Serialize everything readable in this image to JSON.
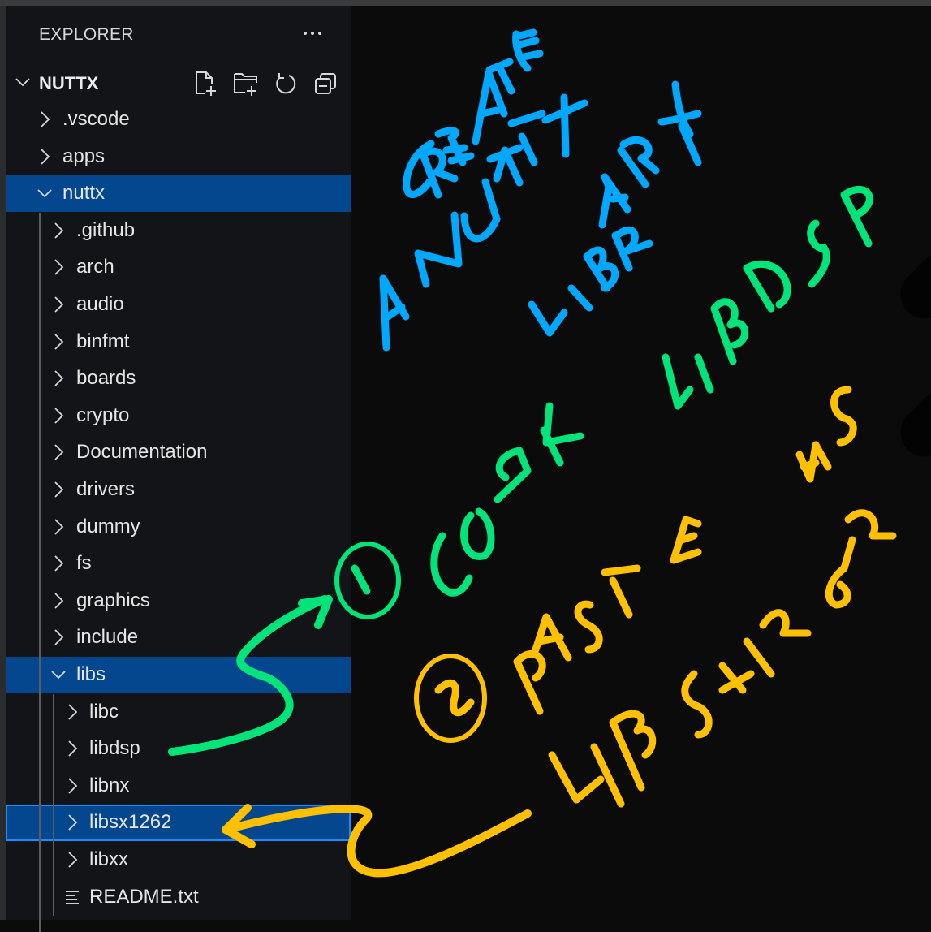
{
  "sidebar": {
    "header": "EXPLORER",
    "more_actions_icon": "ellipsis-icon",
    "root": {
      "label": "NUTTX",
      "expanded": true,
      "actions": [
        {
          "name": "new-file",
          "icon": "new-file-icon"
        },
        {
          "name": "new-folder",
          "icon": "new-folder-icon"
        },
        {
          "name": "refresh",
          "icon": "refresh-icon"
        },
        {
          "name": "collapse-all",
          "icon": "collapse-all-icon"
        }
      ]
    },
    "tree": [
      {
        "label": ".vscode",
        "depth": 0,
        "type": "folder",
        "expanded": false
      },
      {
        "label": "apps",
        "depth": 0,
        "type": "folder",
        "expanded": false
      },
      {
        "label": "nuttx",
        "depth": 0,
        "type": "folder",
        "expanded": true,
        "selected": true
      },
      {
        "label": ".github",
        "depth": 1,
        "type": "folder",
        "expanded": false
      },
      {
        "label": "arch",
        "depth": 1,
        "type": "folder",
        "expanded": false
      },
      {
        "label": "audio",
        "depth": 1,
        "type": "folder",
        "expanded": false
      },
      {
        "label": "binfmt",
        "depth": 1,
        "type": "folder",
        "expanded": false
      },
      {
        "label": "boards",
        "depth": 1,
        "type": "folder",
        "expanded": false
      },
      {
        "label": "crypto",
        "depth": 1,
        "type": "folder",
        "expanded": false
      },
      {
        "label": "Documentation",
        "depth": 1,
        "type": "folder",
        "expanded": false
      },
      {
        "label": "drivers",
        "depth": 1,
        "type": "folder",
        "expanded": false
      },
      {
        "label": "dummy",
        "depth": 1,
        "type": "folder",
        "expanded": false
      },
      {
        "label": "fs",
        "depth": 1,
        "type": "folder",
        "expanded": false
      },
      {
        "label": "graphics",
        "depth": 1,
        "type": "folder",
        "expanded": false
      },
      {
        "label": "include",
        "depth": 1,
        "type": "folder",
        "expanded": false
      },
      {
        "label": "libs",
        "depth": 1,
        "type": "folder",
        "expanded": true,
        "selected": true
      },
      {
        "label": "libc",
        "depth": 2,
        "type": "folder",
        "expanded": false
      },
      {
        "label": "libdsp",
        "depth": 2,
        "type": "folder",
        "expanded": false
      },
      {
        "label": "libnx",
        "depth": 2,
        "type": "folder",
        "expanded": false
      },
      {
        "label": "libsx1262",
        "depth": 2,
        "type": "folder",
        "expanded": false,
        "selected": true,
        "focused": true
      },
      {
        "label": "libxx",
        "depth": 2,
        "type": "folder",
        "expanded": false
      },
      {
        "label": "README.txt",
        "depth": 2,
        "type": "file",
        "icon": "text-file-icon"
      }
    ]
  },
  "annotations": {
    "title_lines": [
      "CREATE",
      "A NUTTX",
      "LIBRARY"
    ],
    "step1": {
      "number": "1",
      "text": "COPY LIBDSP"
    },
    "step2": {
      "number": "2",
      "text": "PASTE AS LIBSX1262"
    },
    "colors": {
      "title": "#00a8ff",
      "step1": "#00e47a",
      "step2": "#ffc000"
    }
  },
  "colors": {
    "sidebar_bg": "#131418",
    "selection_bg": "#04478f",
    "focus_border": "#1a8cff",
    "canvas_bg": "#0b0b0b"
  }
}
